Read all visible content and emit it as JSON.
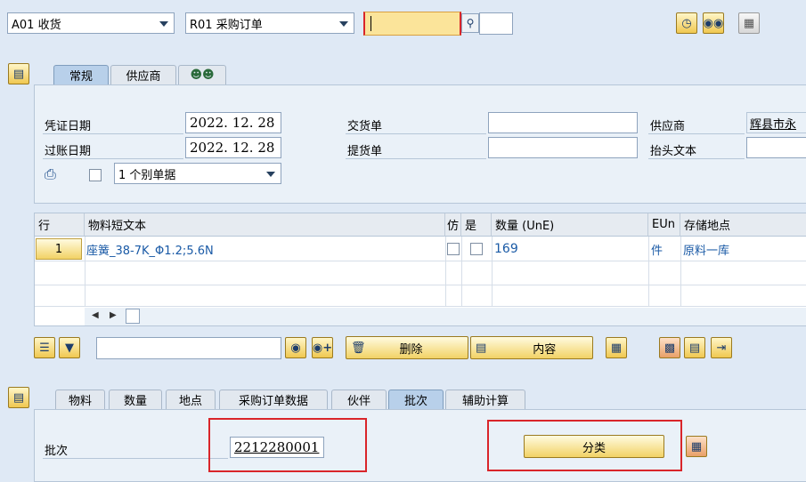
{
  "toolbar": {
    "action_select": "A01 收货",
    "reference_select": "R01 采购订单",
    "order_input_value": "",
    "secondary_input_value": ""
  },
  "header_tabs": [
    {
      "label": "常规",
      "active": true
    },
    {
      "label": "供应商",
      "active": false
    },
    {
      "label": "",
      "icon": "people-icon",
      "active": false
    }
  ],
  "header": {
    "doc_date_label": "凭证日期",
    "doc_date": "2022. 12. 28",
    "post_date_label": "过账日期",
    "post_date": "2022. 12. 28",
    "delivery_note_label": "交货单",
    "bill_of_lading_label": "提货单",
    "vendor_label": "供应商",
    "vendor_value": "辉县市永",
    "header_text_label": "抬头文本",
    "slip_select": "1 个别单据"
  },
  "table": {
    "columns": [
      "行",
      "物料短文本",
      "仿",
      "是",
      "数量 (UnE)",
      "EUn",
      "存储地点"
    ],
    "rows": [
      {
        "line": "1",
        "material": "座簧_38-7K_Φ1.2;5.6N",
        "qty": "169",
        "unit": "件",
        "location": "原料一库"
      }
    ]
  },
  "item_actions": {
    "delete_label": "删除",
    "content_label": "内容"
  },
  "detail_tabs": [
    {
      "label": "物料",
      "active": false
    },
    {
      "label": "数量",
      "active": false
    },
    {
      "label": "地点",
      "active": false
    },
    {
      "label": "采购订单数据",
      "active": false
    },
    {
      "label": "伙伴",
      "active": false
    },
    {
      "label": "批次",
      "active": true
    },
    {
      "label": "辅助计算",
      "active": false
    }
  ],
  "detail": {
    "batch_label": "批次",
    "batch_value": "2212280001",
    "classify_label": "分类"
  },
  "colors": {
    "background": "#dfe9f5",
    "panel": "#eaf1f8",
    "button_yellow": "#f2d265",
    "highlight_red": "#d9252a",
    "link_blue": "#1a5aa6"
  }
}
